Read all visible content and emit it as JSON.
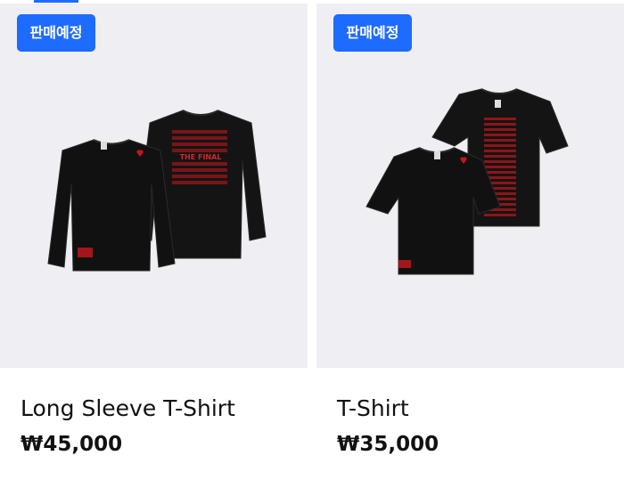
{
  "products": [
    {
      "badge": "판매예정",
      "name": "Long Sleeve T-Shirt",
      "price": "₩45,000",
      "garment_color": "#121212",
      "accent_color": "#c4161c",
      "back_print": "THE FINAL"
    },
    {
      "badge": "판매예정",
      "name": "T-Shirt",
      "price": "₩35,000",
      "garment_color": "#121212",
      "accent_color": "#c4161c"
    }
  ],
  "colors": {
    "badge_bg": "#1e6bff",
    "thumb_bg": "#eeeef3",
    "text": "#111111"
  }
}
